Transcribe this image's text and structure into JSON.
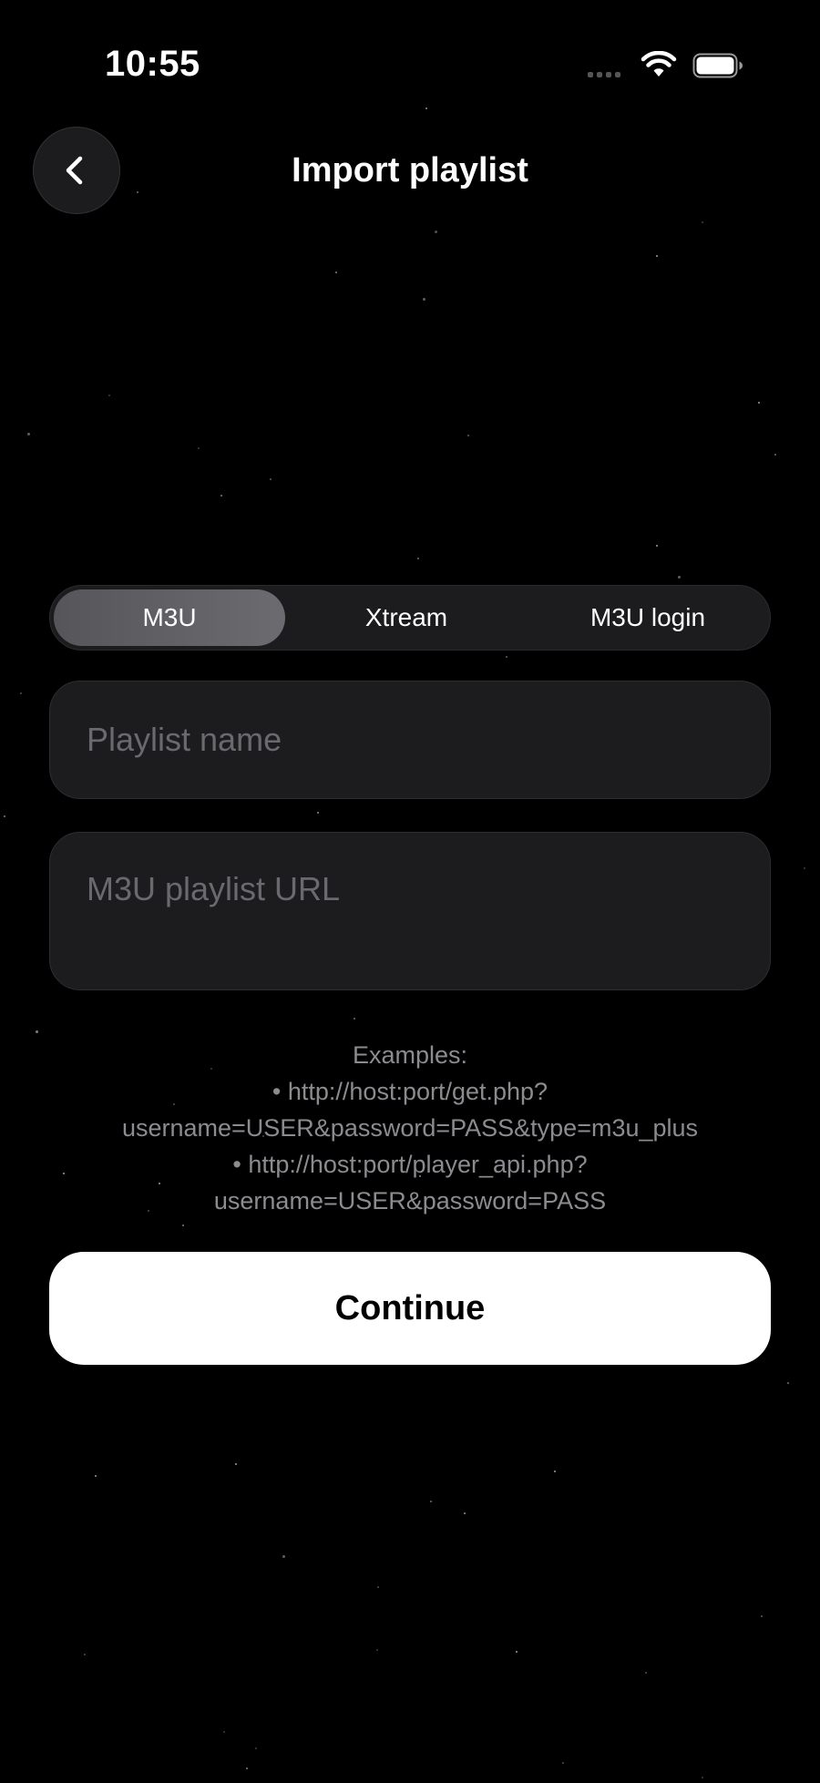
{
  "status_bar": {
    "time": "10:55"
  },
  "header": {
    "title": "Import playlist",
    "back_icon": "chevron-left-icon"
  },
  "tabs": [
    {
      "label": "M3U",
      "selected": true
    },
    {
      "label": "Xtream",
      "selected": false
    },
    {
      "label": "M3U login",
      "selected": false
    }
  ],
  "form": {
    "playlist_name": {
      "value": "",
      "placeholder": "Playlist name"
    },
    "playlist_url": {
      "value": "",
      "placeholder": "M3U playlist URL"
    }
  },
  "examples": {
    "heading": "Examples:",
    "lines": [
      "• http://host:port/get.php?",
      "username=USER&password=PASS&type=m3u_plus",
      "• http://host:port/player_api.php?",
      "username=USER&password=PASS"
    ]
  },
  "continue_label": "Continue",
  "colors": {
    "background": "#000000",
    "surface": "#1c1c1e",
    "selected_tab": "#5e5e63",
    "placeholder": "#6a6a6e",
    "hint_text": "#8b8b90",
    "primary_button": "#ffffff"
  }
}
